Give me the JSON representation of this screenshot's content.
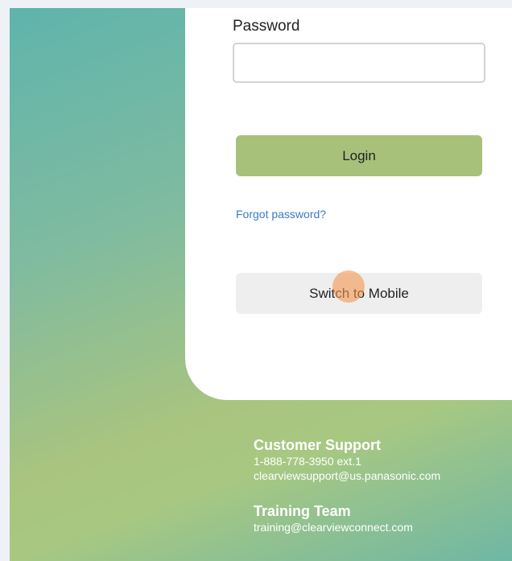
{
  "login_form": {
    "password_label": "Password",
    "password_value": "",
    "login_button": "Login",
    "forgot_link": "Forgot password?",
    "mobile_button": "Switch to Mobile"
  },
  "footer": {
    "support_heading": "Customer Support",
    "support_phone": "1-888-778-3950 ext.1",
    "support_email": "clearviewsupport@us.panasonic.com",
    "training_heading": "Training Team",
    "training_email": "training@clearviewconnect.com"
  },
  "colors": {
    "login_button": "#a7c17a",
    "link": "#3b7bc4",
    "gradient_teal": "#5fb4ac",
    "gradient_green": "#a9c47f"
  }
}
